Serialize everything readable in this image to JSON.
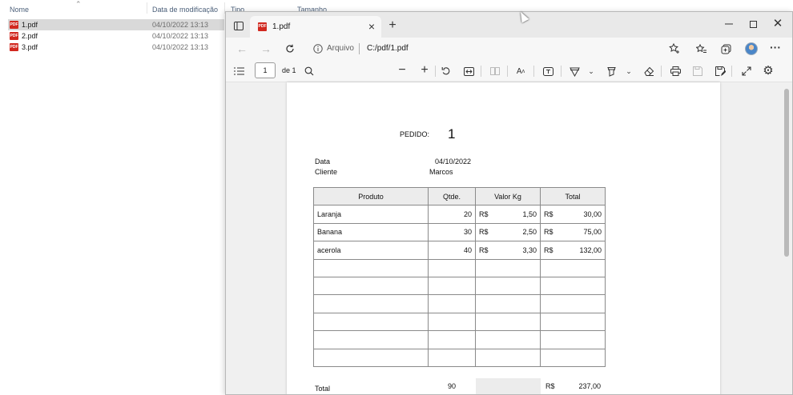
{
  "explorer": {
    "columns": {
      "name": "Nome",
      "modified": "Data de modificação",
      "type": "Tipo",
      "size": "Tamanho"
    },
    "files": [
      {
        "name": "1.pdf",
        "modified": "04/10/2022 13:13",
        "selected": true
      },
      {
        "name": "2.pdf",
        "modified": "04/10/2022 13:13",
        "selected": false
      },
      {
        "name": "3.pdf",
        "modified": "04/10/2022 13:13",
        "selected": false
      }
    ],
    "pdf_icon_text": "PDF"
  },
  "browser": {
    "tab": {
      "title": "1.pdf"
    },
    "address": {
      "label": "Arquivo",
      "url": "C:/pdf/1.pdf"
    },
    "pdf_toolbar": {
      "page": "1",
      "page_of": "de 1"
    },
    "colors": {
      "pdf_icon": "#d1281f",
      "tabstrip": "#e9e9e9",
      "toolbar": "#f7f7f7",
      "viewer_bg": "#f0f0f0"
    }
  },
  "document": {
    "pedido_label": "PEDIDO:",
    "pedido_number": "1",
    "data_label": "Data",
    "data_value": "04/10/2022",
    "cliente_label": "Cliente",
    "cliente_value": "Marcos",
    "headers": {
      "produto": "Produto",
      "qtde": "Qtde.",
      "valor": "Valor Kg",
      "total": "Total"
    },
    "currency": "R$",
    "rows": [
      {
        "produto": "Laranja",
        "qtde": "20",
        "valor": "1,50",
        "total": "30,00"
      },
      {
        "produto": "Banana",
        "qtde": "30",
        "valor": "2,50",
        "total": "75,00"
      },
      {
        "produto": "acerola",
        "qtde": "40",
        "valor": "3,30",
        "total": "132,00"
      }
    ],
    "empty_rows": 6,
    "total_label": "Total",
    "total_qtde": "90",
    "total_value": "237,00"
  }
}
